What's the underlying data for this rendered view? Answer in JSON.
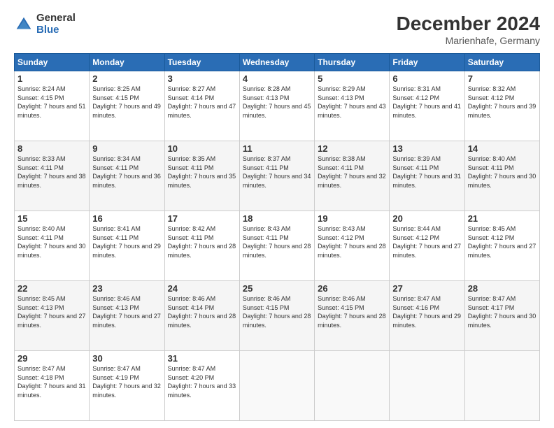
{
  "header": {
    "logo_general": "General",
    "logo_blue": "Blue",
    "title": "December 2024",
    "subtitle": "Marienhafe, Germany"
  },
  "days_of_week": [
    "Sunday",
    "Monday",
    "Tuesday",
    "Wednesday",
    "Thursday",
    "Friday",
    "Saturday"
  ],
  "weeks": [
    [
      {
        "day": "1",
        "sunrise": "8:24 AM",
        "sunset": "4:15 PM",
        "daylight": "7 hours and 51 minutes."
      },
      {
        "day": "2",
        "sunrise": "8:25 AM",
        "sunset": "4:15 PM",
        "daylight": "7 hours and 49 minutes."
      },
      {
        "day": "3",
        "sunrise": "8:27 AM",
        "sunset": "4:14 PM",
        "daylight": "7 hours and 47 minutes."
      },
      {
        "day": "4",
        "sunrise": "8:28 AM",
        "sunset": "4:13 PM",
        "daylight": "7 hours and 45 minutes."
      },
      {
        "day": "5",
        "sunrise": "8:29 AM",
        "sunset": "4:13 PM",
        "daylight": "7 hours and 43 minutes."
      },
      {
        "day": "6",
        "sunrise": "8:31 AM",
        "sunset": "4:12 PM",
        "daylight": "7 hours and 41 minutes."
      },
      {
        "day": "7",
        "sunrise": "8:32 AM",
        "sunset": "4:12 PM",
        "daylight": "7 hours and 39 minutes."
      }
    ],
    [
      {
        "day": "8",
        "sunrise": "8:33 AM",
        "sunset": "4:11 PM",
        "daylight": "7 hours and 38 minutes."
      },
      {
        "day": "9",
        "sunrise": "8:34 AM",
        "sunset": "4:11 PM",
        "daylight": "7 hours and 36 minutes."
      },
      {
        "day": "10",
        "sunrise": "8:35 AM",
        "sunset": "4:11 PM",
        "daylight": "7 hours and 35 minutes."
      },
      {
        "day": "11",
        "sunrise": "8:37 AM",
        "sunset": "4:11 PM",
        "daylight": "7 hours and 34 minutes."
      },
      {
        "day": "12",
        "sunrise": "8:38 AM",
        "sunset": "4:11 PM",
        "daylight": "7 hours and 32 minutes."
      },
      {
        "day": "13",
        "sunrise": "8:39 AM",
        "sunset": "4:11 PM",
        "daylight": "7 hours and 31 minutes."
      },
      {
        "day": "14",
        "sunrise": "8:40 AM",
        "sunset": "4:11 PM",
        "daylight": "7 hours and 30 minutes."
      }
    ],
    [
      {
        "day": "15",
        "sunrise": "8:40 AM",
        "sunset": "4:11 PM",
        "daylight": "7 hours and 30 minutes."
      },
      {
        "day": "16",
        "sunrise": "8:41 AM",
        "sunset": "4:11 PM",
        "daylight": "7 hours and 29 minutes."
      },
      {
        "day": "17",
        "sunrise": "8:42 AM",
        "sunset": "4:11 PM",
        "daylight": "7 hours and 28 minutes."
      },
      {
        "day": "18",
        "sunrise": "8:43 AM",
        "sunset": "4:11 PM",
        "daylight": "7 hours and 28 minutes."
      },
      {
        "day": "19",
        "sunrise": "8:43 AM",
        "sunset": "4:12 PM",
        "daylight": "7 hours and 28 minutes."
      },
      {
        "day": "20",
        "sunrise": "8:44 AM",
        "sunset": "4:12 PM",
        "daylight": "7 hours and 27 minutes."
      },
      {
        "day": "21",
        "sunrise": "8:45 AM",
        "sunset": "4:12 PM",
        "daylight": "7 hours and 27 minutes."
      }
    ],
    [
      {
        "day": "22",
        "sunrise": "8:45 AM",
        "sunset": "4:13 PM",
        "daylight": "7 hours and 27 minutes."
      },
      {
        "day": "23",
        "sunrise": "8:46 AM",
        "sunset": "4:13 PM",
        "daylight": "7 hours and 27 minutes."
      },
      {
        "day": "24",
        "sunrise": "8:46 AM",
        "sunset": "4:14 PM",
        "daylight": "7 hours and 28 minutes."
      },
      {
        "day": "25",
        "sunrise": "8:46 AM",
        "sunset": "4:15 PM",
        "daylight": "7 hours and 28 minutes."
      },
      {
        "day": "26",
        "sunrise": "8:46 AM",
        "sunset": "4:15 PM",
        "daylight": "7 hours and 28 minutes."
      },
      {
        "day": "27",
        "sunrise": "8:47 AM",
        "sunset": "4:16 PM",
        "daylight": "7 hours and 29 minutes."
      },
      {
        "day": "28",
        "sunrise": "8:47 AM",
        "sunset": "4:17 PM",
        "daylight": "7 hours and 30 minutes."
      }
    ],
    [
      {
        "day": "29",
        "sunrise": "8:47 AM",
        "sunset": "4:18 PM",
        "daylight": "7 hours and 31 minutes."
      },
      {
        "day": "30",
        "sunrise": "8:47 AM",
        "sunset": "4:19 PM",
        "daylight": "7 hours and 32 minutes."
      },
      {
        "day": "31",
        "sunrise": "8:47 AM",
        "sunset": "4:20 PM",
        "daylight": "7 hours and 33 minutes."
      },
      null,
      null,
      null,
      null
    ]
  ]
}
